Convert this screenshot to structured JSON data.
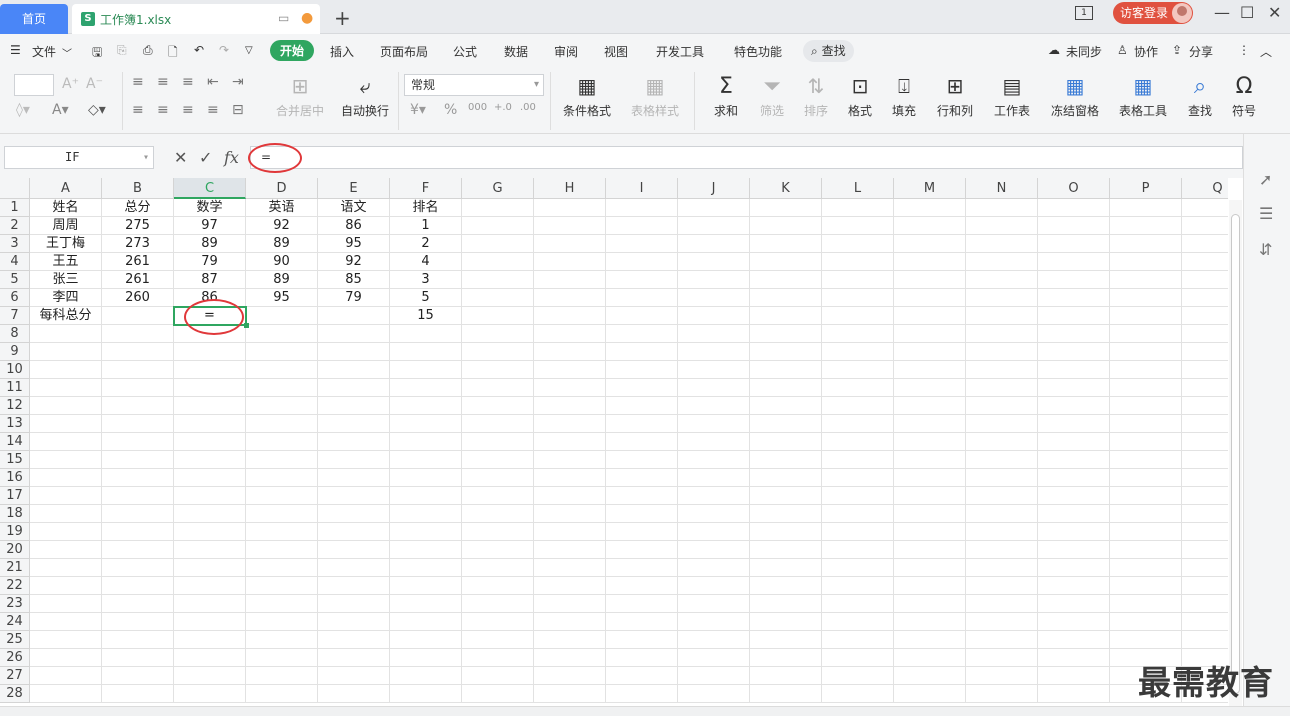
{
  "titlebar": {
    "home_tab": "首页",
    "file_tab": "工作簿1.xlsx",
    "file_logo": "S",
    "badge": "1",
    "login": "访客登录"
  },
  "menu": {
    "file": "文件",
    "items": [
      "开始",
      "插入",
      "页面布局",
      "公式",
      "数据",
      "审阅",
      "视图",
      "开发工具",
      "特色功能"
    ],
    "search": "查找",
    "unsynced": "未同步",
    "collab": "协作",
    "share": "分享"
  },
  "ribbon": {
    "merge_center": "合并居中",
    "wrap_text": "自动换行",
    "number_format": "常规",
    "cond_format": "条件格式",
    "table_style": "表格样式",
    "sum": "求和",
    "filter": "筛选",
    "sort": "排序",
    "format": "格式",
    "fill": "填充",
    "row_col": "行和列",
    "worksheet": "工作表",
    "freeze": "冻结窗格",
    "table_tools": "表格工具",
    "find": "查找",
    "symbol": "符号"
  },
  "formula_bar": {
    "name_box": "IF",
    "fx": "fx",
    "formula": "="
  },
  "sheet": {
    "columns": [
      "A",
      "B",
      "C",
      "D",
      "E",
      "F",
      "G",
      "H",
      "I",
      "J",
      "K",
      "L",
      "M",
      "N",
      "O",
      "P",
      "Q"
    ],
    "selected_column": "C",
    "rows": [
      "1",
      "2",
      "3",
      "4",
      "5",
      "6",
      "7",
      "8",
      "9",
      "10",
      "11",
      "12",
      "13",
      "14",
      "15",
      "16",
      "17",
      "18",
      "19",
      "20",
      "21",
      "22",
      "23",
      "24",
      "25",
      "26",
      "27",
      "28"
    ],
    "cells": [
      [
        "姓名",
        "总分",
        "数学",
        "英语",
        "语文",
        "排名"
      ],
      [
        "周周",
        "275",
        "97",
        "92",
        "86",
        "1"
      ],
      [
        "王丁梅",
        "273",
        "89",
        "89",
        "95",
        "2"
      ],
      [
        "王五",
        "261",
        "79",
        "90",
        "92",
        "4"
      ],
      [
        "张三",
        "261",
        "87",
        "89",
        "85",
        "3"
      ],
      [
        "李四",
        "260",
        "86",
        "95",
        "79",
        "5"
      ],
      [
        "每科总分",
        "",
        "=",
        "",
        "",
        "15"
      ]
    ]
  },
  "watermark": "最需教育",
  "colors": {
    "accent": "#2fa660",
    "home_tab": "#4a86f7",
    "annotation": "#e0383a",
    "login": "#e0513f"
  }
}
